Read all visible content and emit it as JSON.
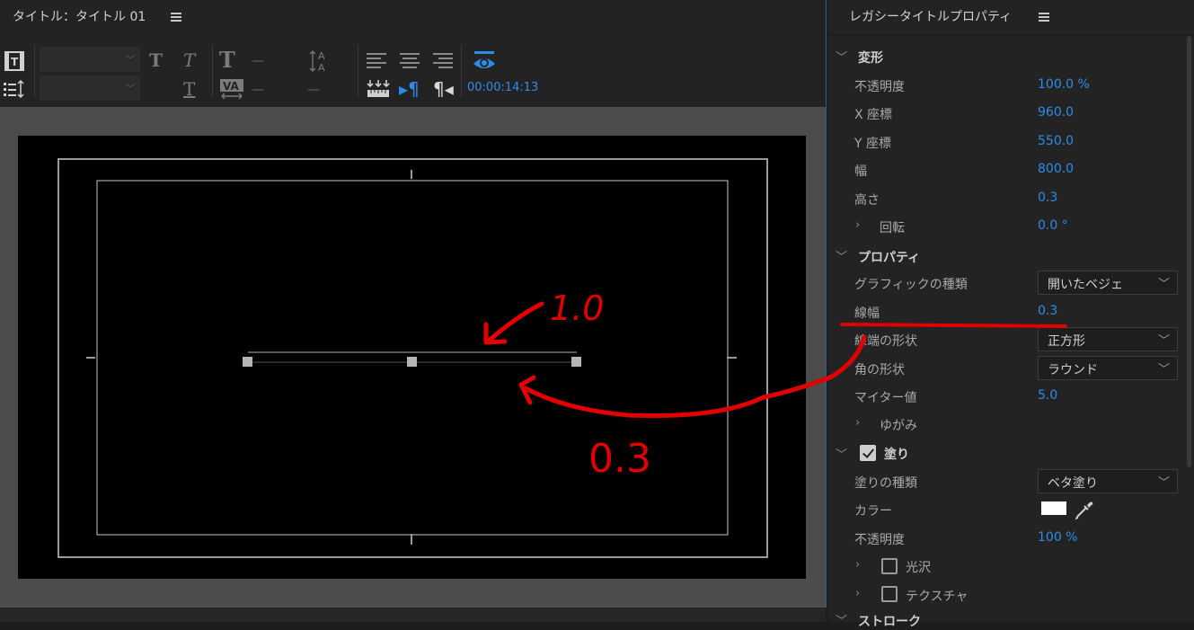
{
  "left_panel": {
    "tab_title": "タイトル：タイトル 01"
  },
  "toolbar": {
    "timecode": "00:00:14:13",
    "icons": [
      "title-tool-icon",
      "tab-stops-icon",
      "bold-icon",
      "italic-icon",
      "underline-icon",
      "font-size-icon",
      "kerning-icon",
      "leading-icon",
      "align-left-icon",
      "align-center-icon",
      "align-right-icon",
      "tab-stop-ruler-icon",
      "paragraph-rtl-icon",
      "paragraph-ltr-icon",
      "show-background-video-icon"
    ]
  },
  "annotations": {
    "label_top": "1.0",
    "label_bottom": "0.3",
    "color": "#e00000"
  },
  "right_panel": {
    "title": "レガシータイトルプロパティ",
    "transform": {
      "header": "変形",
      "rows": [
        {
          "label": "不透明度",
          "value": "100.0 %"
        },
        {
          "label": "X 座標",
          "value": "960.0"
        },
        {
          "label": "Y 座標",
          "value": "550.0"
        },
        {
          "label": "幅",
          "value": "800.0"
        },
        {
          "label": "高さ",
          "value": "0.3"
        },
        {
          "label": "回転",
          "value": "0.0 °"
        }
      ]
    },
    "properties": {
      "header": "プロパティ",
      "graphic_type": {
        "label": "グラフィックの種類",
        "value": "開いたベジェ"
      },
      "line_width": {
        "label": "線幅",
        "value": "0.3"
      },
      "cap_type": {
        "label": "線端の形状",
        "value": "正方形"
      },
      "join_type": {
        "label": "角の形状",
        "value": "ラウンド"
      },
      "miter_limit": {
        "label": "マイター値",
        "value": "5.0"
      },
      "distort": "ゆがみ"
    },
    "fill": {
      "header": "塗り",
      "checked": true,
      "fill_type": {
        "label": "塗りの種類",
        "value": "ベタ塗り"
      },
      "color": {
        "label": "カラー",
        "value": "#ffffff"
      },
      "opacity": {
        "label": "不透明度",
        "value": "100 %"
      },
      "sheen": {
        "label": "光沢",
        "checked": false
      },
      "texture": {
        "label": "テクスチャ",
        "checked": false
      }
    },
    "stroke": {
      "header": "ストローク"
    }
  }
}
